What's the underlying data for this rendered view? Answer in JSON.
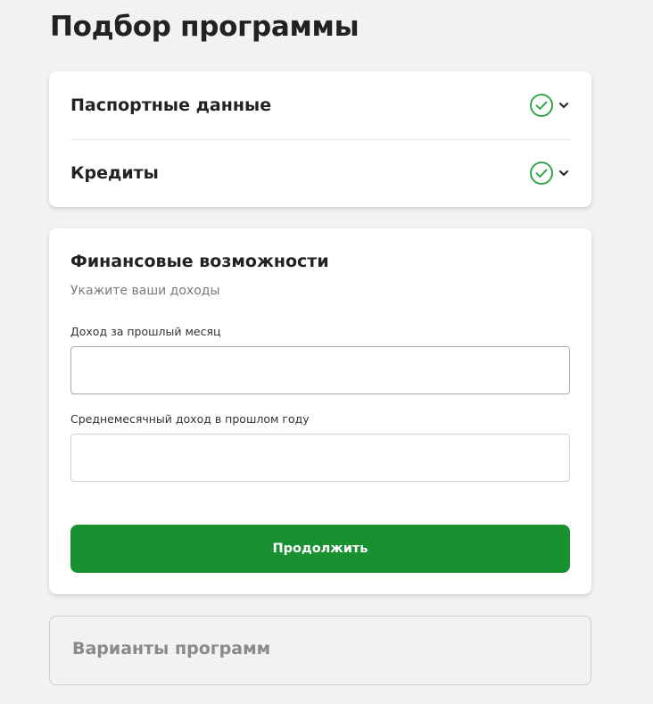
{
  "page": {
    "title": "Подбор программы"
  },
  "steps": [
    {
      "label": "Паспортные данные",
      "status_icon": "check-circle-icon",
      "expand_icon": "chevron-down-icon"
    },
    {
      "label": "Кредиты",
      "status_icon": "check-circle-icon",
      "expand_icon": "chevron-down-icon"
    }
  ],
  "finance": {
    "title": "Финансовые возможности",
    "subtitle": "Укажите ваши доходы",
    "fields": [
      {
        "label": "Доход за прошлый месяц",
        "value": "",
        "placeholder": ""
      },
      {
        "label": "Среднемесячный доход в прошлом году",
        "value": "",
        "placeholder": ""
      }
    ],
    "continue_label": "Продолжить"
  },
  "variants": {
    "label": "Варианты программ"
  },
  "colors": {
    "background": "#f2f2f2",
    "accent_green": "#1a9131",
    "check_green": "#21a038",
    "muted_text": "#8a8a8a"
  }
}
